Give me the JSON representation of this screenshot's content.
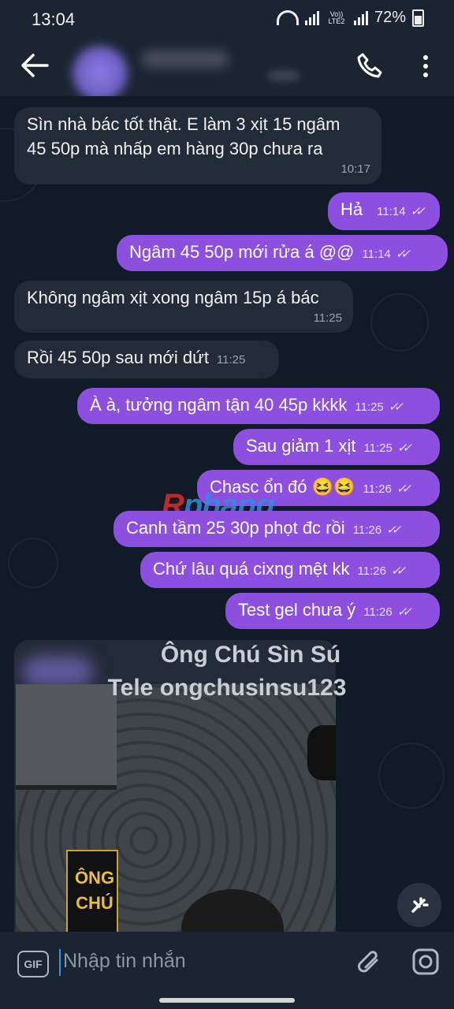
{
  "status_bar": {
    "time": "13:04",
    "network": "Vo)) LTE2",
    "battery": "72%"
  },
  "header": {
    "back_icon": "arrow-left-icon",
    "call_icon": "phone-icon",
    "more_icon": "more-vertical-icon"
  },
  "messages": [
    {
      "dir": "in",
      "lines": [
        "Sìn nhà bác tốt thật. E làm 3 xịt 15 ngâm",
        "45 50p mà nhấp em hàng 30p chưa ra"
      ],
      "time": "10:17"
    },
    {
      "dir": "out",
      "text": "Hả",
      "time": "11:14"
    },
    {
      "dir": "out",
      "text": "Ngâm 45 50p mới rửa á @@",
      "time": "11:14"
    },
    {
      "dir": "in",
      "text": "Không ngâm xịt xong ngâm 15p á bác",
      "time": "11:25"
    },
    {
      "dir": "in",
      "text": "Rồi 45 50p sau mới dứt",
      "time": "11:25"
    },
    {
      "dir": "out",
      "text": "À à, tưởng ngâm tận 40 45p kkkk",
      "time": "11:25"
    },
    {
      "dir": "out",
      "text": "Sau giảm 1 xịt",
      "time": "11:25"
    },
    {
      "dir": "out",
      "text": "Chasc ổn đó 😆😆",
      "time": "11:26"
    },
    {
      "dir": "out",
      "text": "Canh tầm 25 30p phọt đc rồi",
      "time": "11:26"
    },
    {
      "dir": "out",
      "text": "Chứ lâu quá cixng mệt kk",
      "time": "11:26"
    },
    {
      "dir": "out",
      "text": "Test gel chưa ý",
      "time": "11:26"
    }
  ],
  "watermark": {
    "part1": "R",
    "part2": "phang"
  },
  "media": {
    "caption_line1": "Ông Chú Sìn Sú",
    "caption_line2": "Tele ongchusinsu123",
    "box_label": "ÔNG CHÚ"
  },
  "input": {
    "gif_label": "GIF",
    "placeholder": "Nhập tin nhắn",
    "attach_icon": "paperclip-icon",
    "camera_icon": "camera-icon"
  },
  "colors": {
    "outgoing": "#8c4fe0",
    "incoming": "#222c38",
    "background": "#111b27",
    "header": "#1b2531"
  }
}
